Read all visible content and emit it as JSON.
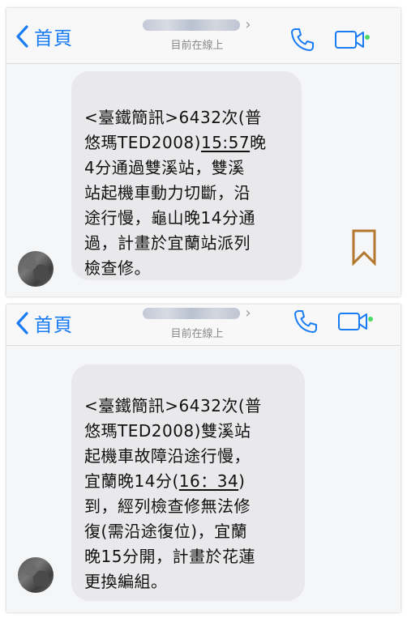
{
  "screenshots": [
    {
      "header": {
        "back_label": "首頁",
        "status": "目前在線上"
      },
      "message": {
        "lines": [
          [
            "<臺鐵簡訊>6432次(普"
          ],
          [
            "悠瑪TED2008)",
            {
              "u": "15:57"
            },
            "晚"
          ],
          [
            "4分通過雙溪站，雙溪"
          ],
          [
            "站起機車動力切斷，沿"
          ],
          [
            "途行慢，龜山晚14分通"
          ],
          [
            "過，計畫於宜蘭站派列"
          ],
          [
            "檢查修。"
          ]
        ]
      }
    },
    {
      "header": {
        "back_label": "首頁",
        "status": "目前在線上"
      },
      "message": {
        "lines": [
          [
            "<臺鐵簡訊>6432次(普"
          ],
          [
            "悠瑪TED2008)雙溪站"
          ],
          [
            "起機車故障沿途行慢，"
          ],
          [
            "宜蘭晚14分(",
            {
              "u": "16：34"
            },
            ")"
          ],
          [
            "到，經列檢查修無法修"
          ],
          [
            "復(需沿途復位)，宜蘭"
          ],
          [
            "晚15分開，計畫於花蓮"
          ],
          [
            "更換編組。"
          ]
        ]
      }
    }
  ],
  "colors": {
    "accent": "#1a7cf5",
    "online": "#4cd964",
    "bubble": "#e9e9eb",
    "bookmark": "#b3772e"
  },
  "icons": {
    "back": "chevron-left-icon",
    "call": "phone-icon",
    "video": "video-camera-icon",
    "bookmark": "bookmark-icon"
  }
}
